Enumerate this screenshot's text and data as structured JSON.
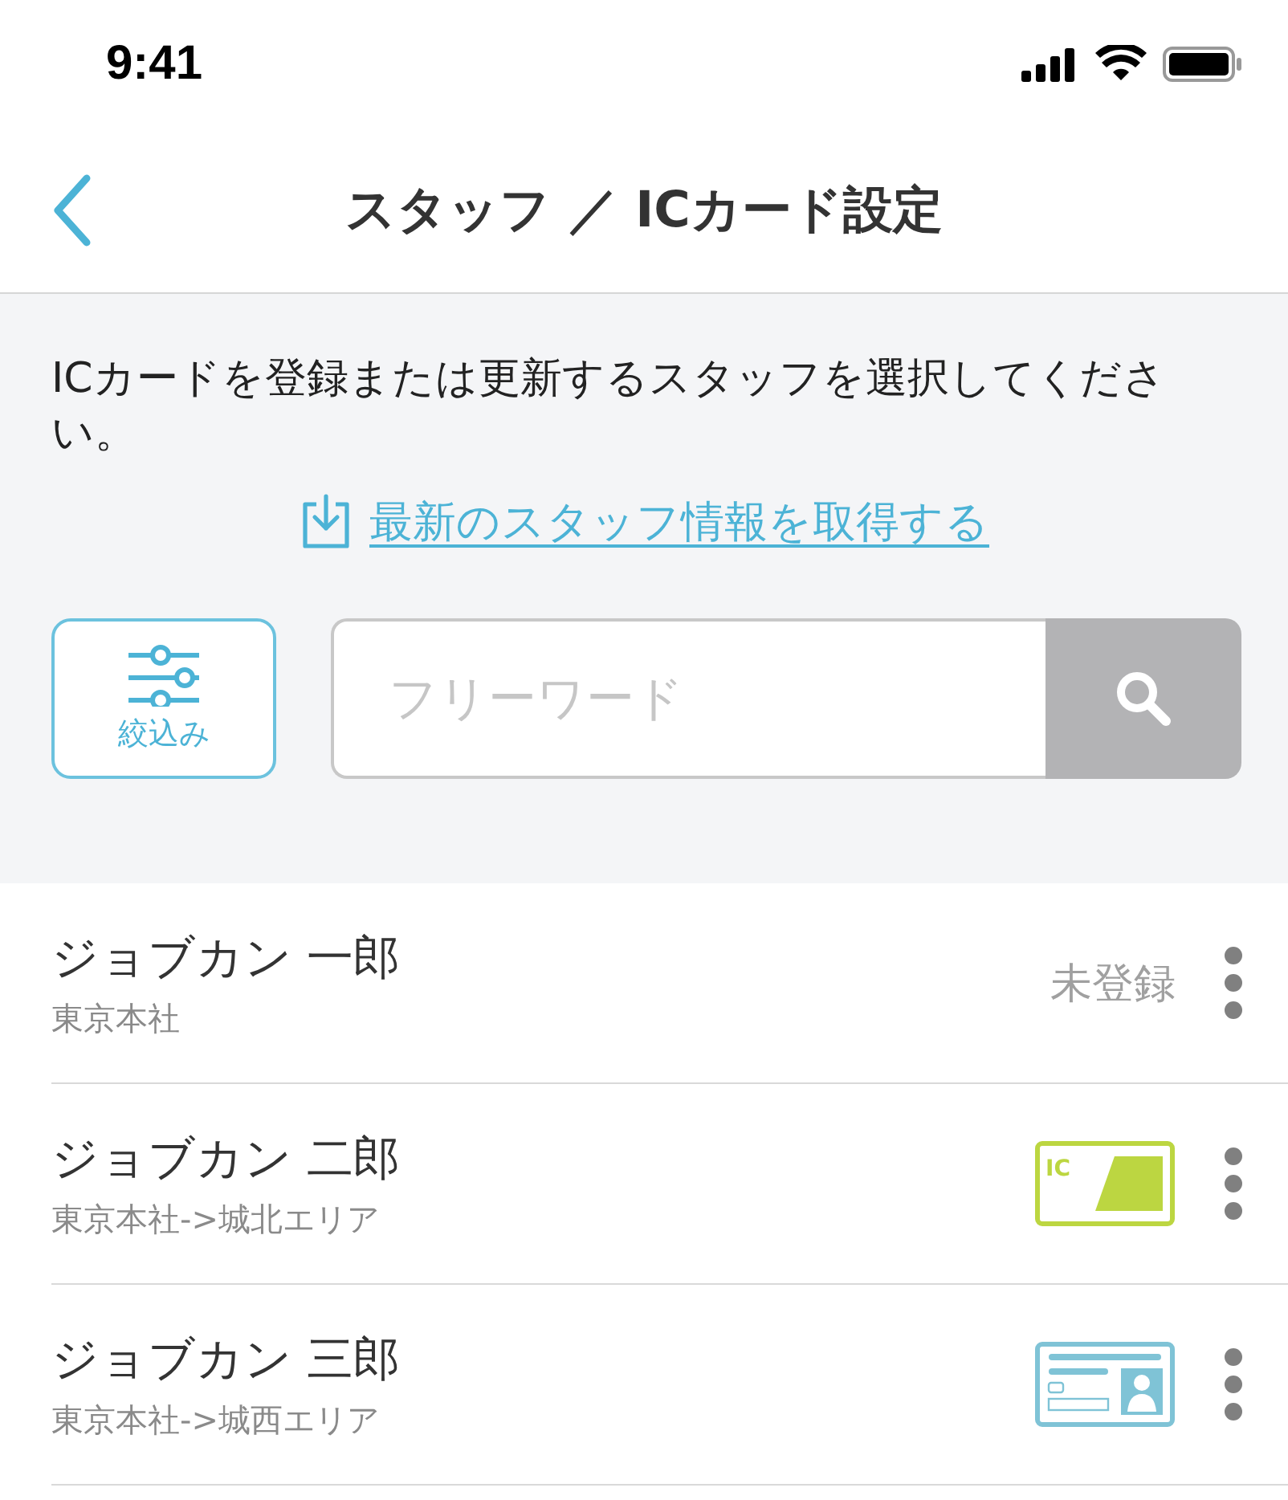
{
  "status_bar": {
    "time": "9:41"
  },
  "nav": {
    "title": "スタッフ ／ ICカード設定"
  },
  "instruction": "ICカードを登録または更新するスタッフを選択してください。",
  "refresh_link": "最新のスタッフ情報を取得する",
  "filter_button": {
    "label": "絞込み"
  },
  "search": {
    "placeholder": "フリーワード"
  },
  "staff": [
    {
      "name": "ジョブカン 一郎",
      "department": "東京本社",
      "kind": "unregistered",
      "status": "未登録"
    },
    {
      "name": "ジョブカン 二郎",
      "department": "東京本社->城北エリア",
      "kind": "ic_card",
      "card_text": "IC"
    },
    {
      "name": "ジョブカン 三郎",
      "department": "東京本社->城西エリア",
      "kind": "id_card"
    }
  ]
}
